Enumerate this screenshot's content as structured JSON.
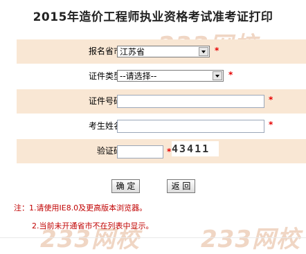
{
  "page": {
    "title": "2015年造价工程师执业资格考试准考证打印",
    "watermark": "233网校"
  },
  "form": {
    "province": {
      "label": "报名省市:",
      "value": "江苏省"
    },
    "id_type": {
      "label": "证件类型:",
      "value": "--请选择--"
    },
    "id_number": {
      "label": "证件号码:",
      "value": ""
    },
    "name": {
      "label": "考生姓名:",
      "value": ""
    },
    "captcha": {
      "label": "验证码:",
      "value": "",
      "image_text": "43411"
    },
    "required_mark": "*"
  },
  "buttons": {
    "confirm": "确 定",
    "back": "返 回"
  },
  "notes": {
    "line1": "注：1.请使用IE8.0及更高版本浏览器。",
    "line2": "2.当前未开通省市不在列表中显示。"
  },
  "colors": {
    "row_shade": "#f9e7d4",
    "required": "#e60000",
    "note_text": "#c00000"
  }
}
